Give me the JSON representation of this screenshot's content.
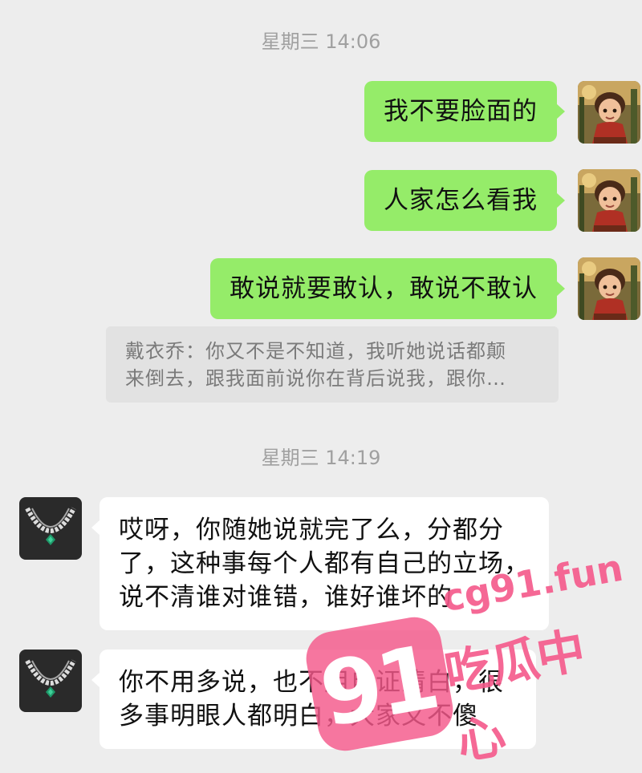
{
  "timestamps": [
    "星期三 14:06",
    "星期三 14:19"
  ],
  "messages_out": [
    {
      "text": "我不要脸面的"
    },
    {
      "text": "人家怎么看我"
    },
    {
      "text": "敢说就要敢认，敢说不敢认"
    }
  ],
  "quote": {
    "line1": "戴衣乔：你又不是不知道，我听她说话都颠",
    "line2": "来倒去，跟我面前说你在背后说我，跟你…"
  },
  "messages_in": [
    {
      "lines": [
        "哎呀，你随她说就完了么，分都分",
        "了，这种事每个人都有自己的立场，",
        "说不清谁对谁错，谁好谁坏的"
      ]
    },
    {
      "lines": [
        "你不用多说，也不用自证清白，很",
        "多事明眼人都明白，大家又不傻"
      ]
    }
  ],
  "avatars": {
    "self": "cartoon-boy-avatar",
    "contact": "necklace-avatar"
  },
  "watermark": {
    "badge": "91",
    "domain": "cg91.fun",
    "label": "吃瓜中心",
    "color": "#f4588a"
  }
}
